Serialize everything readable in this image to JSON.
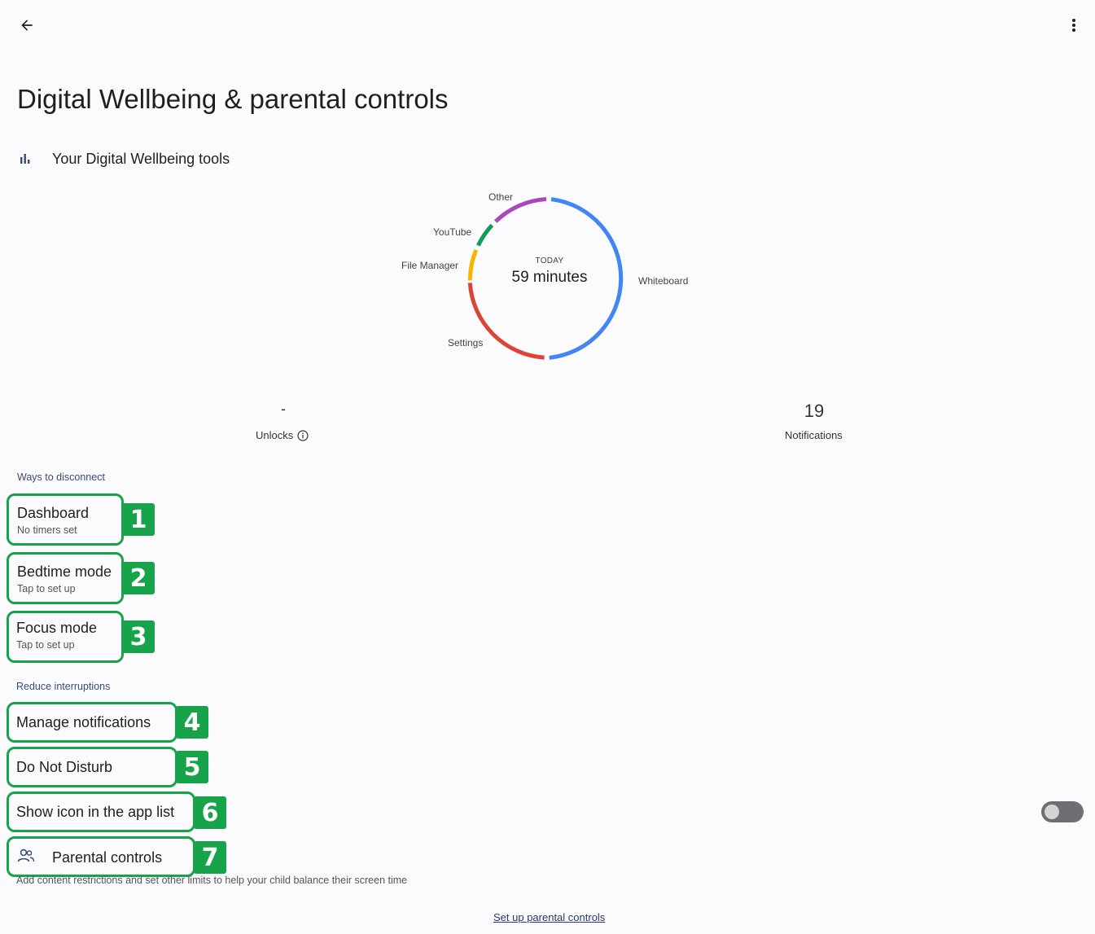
{
  "header": {
    "title": "Digital Wellbeing & parental controls",
    "back_icon": "arrow-back-icon",
    "more_icon": "more-vert-icon"
  },
  "tools": {
    "label": "Your Digital Wellbeing tools",
    "icon": "bar-chart-icon"
  },
  "usage": {
    "today_label": "TODAY",
    "total": "59 minutes",
    "segments": [
      {
        "app": "Whiteboard",
        "color": "#4285f4"
      },
      {
        "app": "Settings",
        "color": "#db4437"
      },
      {
        "app": "File Manager",
        "color": "#f4b400"
      },
      {
        "app": "YouTube",
        "color": "#0f9d58"
      },
      {
        "app": "Other",
        "color": "#ab47bc"
      }
    ]
  },
  "stats": {
    "unlocks_value": "-",
    "unlocks_label": "Unlocks",
    "notifications_value": "19",
    "notifications_label": "Notifications"
  },
  "disconnect": {
    "header": "Ways to disconnect",
    "items": [
      {
        "title": "Dashboard",
        "subtitle": "No timers set",
        "badge": "1"
      },
      {
        "title": "Bedtime mode",
        "subtitle": "Tap to set up",
        "badge": "2"
      },
      {
        "title": "Focus mode",
        "subtitle": "Tap to set up",
        "badge": "3"
      }
    ]
  },
  "interruptions": {
    "header": "Reduce interruptions",
    "items": [
      {
        "title": "Manage notifications",
        "badge": "4"
      },
      {
        "title": "Do Not Disturb",
        "badge": "5"
      },
      {
        "title": "Show icon in the app list",
        "badge": "6",
        "toggle": false
      }
    ]
  },
  "parental": {
    "title": "Parental controls",
    "badge": "7",
    "icon": "supervisor-account-icon",
    "description": "Add content restrictions and set other limits to help your child balance their screen time",
    "setup_link": "Set up parental controls"
  },
  "colors": {
    "accent_green": "#17a34a",
    "section_header": "#3c4a7a"
  }
}
